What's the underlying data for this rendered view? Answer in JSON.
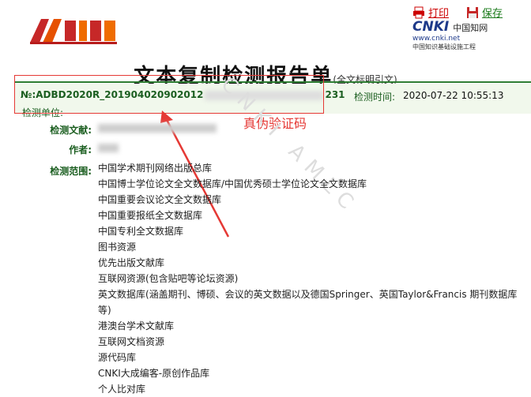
{
  "toolbar": {
    "print_label": "打印",
    "save_label": "保存"
  },
  "brand": {
    "cnki_name": "CNKI",
    "cnki_cn": "中国知网",
    "cnki_url": "www.cnki.net",
    "cnki_subtitle": "中国知识基础设施工程",
    "watermark": "CNKI AMLC"
  },
  "report": {
    "title": "文本复制检测报告单",
    "subtitle": "(全文标明引文)",
    "doc_no_prefix": "№:ADBD2020R_2019040209020​12",
    "doc_no_suffix": "231",
    "check_time_label": "检测时间:",
    "check_time_value": "2020-07-22 10:55:13",
    "unit_label": "检测单位:",
    "annotation": "真伪验证码",
    "doc_label": "检测文献:",
    "author_label": "作者:",
    "range_label": "检测范围:"
  },
  "scope_items": [
    "中国学术期刊网络出版总库",
    "中国博士学位论文全文数据库/中国优秀硕士学位论文全文数据库",
    "中国重要会议论文全文数据库",
    "中国重要报纸全文数据库",
    "中国专利全文数据库",
    "图书资源",
    "优先出版文献库",
    "互联网资源(包含贴吧等论坛资源)",
    "英文数据库(涵盖期刊、博硕、会议的英文数据以及德国Springer、英国Taylor&Francis 期刊数据库等)",
    "港澳台学术文献库",
    "互联网文档资源",
    "源代码库",
    "CNKI大成编客-原创作品库",
    "个人比对库"
  ],
  "colors": {
    "accent_red": "#e53935",
    "label_green": "#1b5e20",
    "band": "#f1f8ec"
  }
}
